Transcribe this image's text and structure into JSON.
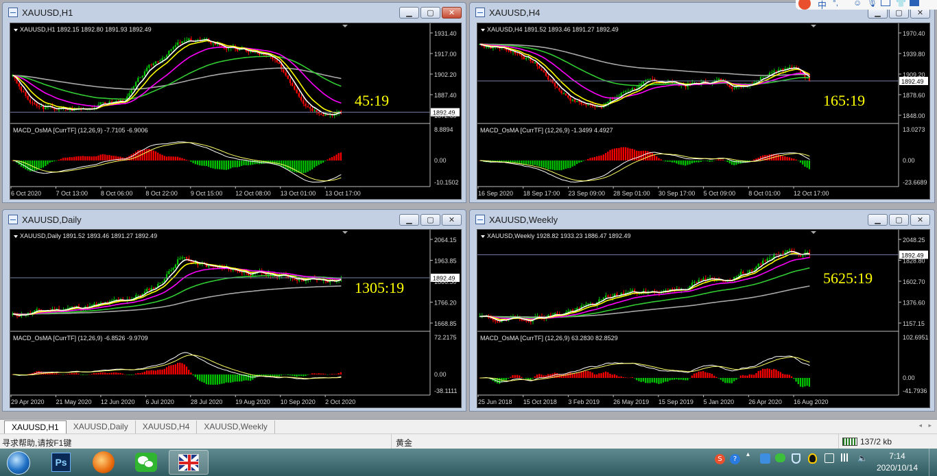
{
  "windows": [
    {
      "title": "XAUUSD,H1",
      "active": true,
      "info": "XAUUSD,H1  1892.15 1892.80 1891.93 1892.49",
      "timer": "45:19",
      "current_price": "1892.49",
      "price_ticks": [
        "1931.40",
        "1917.00",
        "1902.20",
        "1887.40",
        "1872.60"
      ],
      "macd_label": "MACD_OsMA [CurrTF] (12,26,9) -7.7105 -6.9006",
      "macd_ticks": [
        "8.8894",
        "0.00",
        "-10.1502"
      ],
      "time_labels": [
        "6 Oct 2020",
        "7 Oct 13:00",
        "8 Oct 06:00",
        "8 Oct 22:00",
        "9 Oct 15:00",
        "12 Oct 08:00",
        "13 Oct 01:00",
        "13 Oct 17:00"
      ],
      "profile": [
        0.38,
        0.1,
        0.1,
        0.08,
        0.12,
        0.18,
        0.2,
        0.55,
        0.75,
        0.92,
        0.95,
        0.9,
        0.82,
        0.8,
        0.72,
        0.45,
        0.12,
        0.05,
        0.05
      ],
      "start_price": 0.6,
      "seed": 3
    },
    {
      "title": "XAUUSD,H4",
      "active": false,
      "info": "XAUUSD,H4  1891.52 1893.46 1891.27 1892.49",
      "timer": "165:19",
      "current_price": "1892.49",
      "price_ticks": [
        "1970.40",
        "1939.80",
        "1909.20",
        "1878.60",
        "1848.00"
      ],
      "macd_label": "MACD_OsMA [CurrTF] (12,26,9) -1.3499 4.4927",
      "macd_ticks": [
        "13.0273",
        "0.00",
        "-23.6689"
      ],
      "time_labels": [
        "16 Sep 2020",
        "18 Sep 17:00",
        "23 Sep 09:00",
        "28 Sep 01:00",
        "30 Sep 17:00",
        "5 Oct 09:00",
        "8 Oct 01:00",
        "12 Oct 17:00"
      ],
      "profile": [
        0.88,
        0.85,
        0.78,
        0.62,
        0.35,
        0.18,
        0.12,
        0.2,
        0.35,
        0.42,
        0.45,
        0.38,
        0.42,
        0.45,
        0.35,
        0.48,
        0.62,
        0.6,
        0.42
      ],
      "start_price": 0.9,
      "seed": 7
    },
    {
      "title": "XAUUSD,Daily",
      "active": false,
      "info": "XAUUSD,Daily  1891.52 1893.46 1891.27 1892.49",
      "timer": "1305:19",
      "current_price": "1892.49",
      "price_ticks": [
        "2064.15",
        "1963.85",
        "1866.50",
        "1766.20",
        "1668.85"
      ],
      "macd_label": "MACD_OsMA [CurrTF] (12,26,9) -6.8526 -9.9709",
      "macd_ticks": [
        "72.2175",
        "0.00",
        "-38.1111"
      ],
      "time_labels": [
        "29 Apr 2020",
        "21 May 2020",
        "12 Jun 2020",
        "6 Jul 2020",
        "28 Jul 2020",
        "19 Aug 2020",
        "10 Sep 2020",
        "2 Oct 2020"
      ],
      "profile": [
        0.12,
        0.15,
        0.18,
        0.2,
        0.22,
        0.25,
        0.3,
        0.38,
        0.52,
        0.85,
        0.72,
        0.68,
        0.66,
        0.62,
        0.6,
        0.58,
        0.55,
        0.52,
        0.55
      ],
      "start_price": 0.1,
      "seed": 11
    },
    {
      "title": "XAUUSD,Weekly",
      "active": false,
      "info": "XAUUSD,Weekly  1928.82 1933.23 1886.47 1892.49",
      "timer": "5625:19",
      "current_price": "1892.49",
      "price_ticks": [
        "2048.25",
        "1828.80",
        "1602.70",
        "1376.60",
        "1157.15"
      ],
      "macd_label": "MACD_OsMA [CurrTF] (12,26,9) 63.2830 82.8529",
      "macd_ticks": [
        "102.6951",
        "0.00",
        "-41.7936"
      ],
      "time_labels": [
        "25 Jun 2018",
        "15 Oct 2018",
        "3 Feb 2019",
        "26 May 2019",
        "15 Sep 2019",
        "5 Jan 2020",
        "26 Apr 2020",
        "16 Aug 2020"
      ],
      "profile": [
        0.08,
        0.05,
        0.06,
        0.1,
        0.12,
        0.18,
        0.25,
        0.35,
        0.4,
        0.38,
        0.42,
        0.45,
        0.55,
        0.52,
        0.62,
        0.7,
        0.88,
        0.9,
        0.82
      ],
      "start_price": 0.1,
      "seed": 19
    }
  ],
  "tabs": [
    "XAUUSD,H1",
    "XAUUSD,Daily",
    "XAUUSD,H4",
    "XAUUSD,Weekly"
  ],
  "active_tab": 0,
  "status": {
    "help": "寻求帮助,请按F1键",
    "profile": "黄金",
    "traffic": "137/2 kb"
  },
  "taskbar": {
    "apps": [
      "start-orb",
      "photoshop",
      "browser",
      "wechat",
      "mt4-terminal"
    ],
    "clock_time": "7:14",
    "clock_date": "2020/10/14"
  },
  "colors": {
    "chart_bg": "#000000",
    "bull": "#00c800",
    "bear": "#ff0000",
    "ma_white": "#ffffff",
    "ma_yellow": "#ffff00",
    "ma_magenta": "#ff00ff",
    "ma_green": "#32cd32",
    "ma_silver": "#a9a9a9",
    "timer": "#ffff00"
  }
}
